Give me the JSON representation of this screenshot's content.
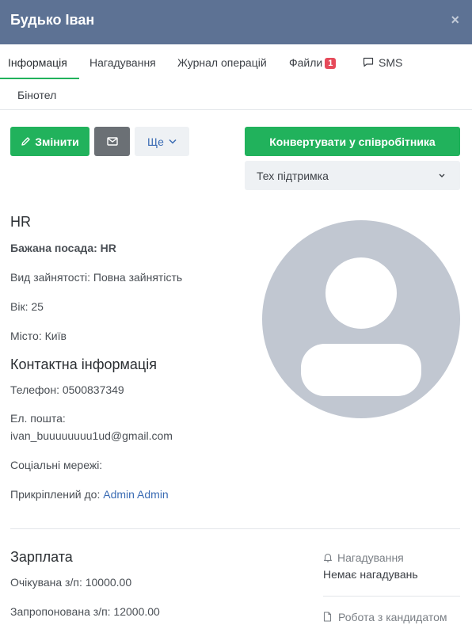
{
  "header": {
    "title": "Будько Іван",
    "close_glyph": "×"
  },
  "tabs": [
    {
      "label": "Інформація"
    },
    {
      "label": "Нагадування"
    },
    {
      "label": "Журнал операцій"
    },
    {
      "label": "Файли",
      "badge": "1"
    },
    {
      "label": "SMS",
      "icon": "chat-icon"
    },
    {
      "label": "Бінотел"
    }
  ],
  "toolbar": {
    "edit_label": "Змінити",
    "mail_icon": "envelope-icon",
    "more_label": "Ще",
    "convert_label": "Конвертувати у співробітника",
    "status_value": "Тех підтримка"
  },
  "info": {
    "title": "HR",
    "position_label": "Бажана посада: HR",
    "employment": "Вид зайнятості: Повна зайнятість",
    "age": "Вік: 25",
    "city": "Місто: Київ"
  },
  "contact": {
    "title": "Контактна інформація",
    "phone": "Телефон: 0500837349",
    "email_label": "Ел. пошта:",
    "email_value": "ivan_buuuuuuuu1ud@gmail.com",
    "social": "Соціальні мережі:",
    "attached_label": "Прикріплений до:",
    "attached_value": "Admin Admin"
  },
  "salary": {
    "title": "Зарплата",
    "expected": "Очікувана з/п: 10000.00",
    "offered": "Запропонована з/п: 12000.00"
  },
  "sidebar": {
    "reminders_label": "Нагадування",
    "reminders_empty": "Немає нагадувань",
    "work_label": "Робота з кандидатом"
  },
  "colors": {
    "header_bg": "#5d7294",
    "accent_green": "#21b25c",
    "link_blue": "#3b6cb4",
    "badge_red": "#e64a5a",
    "avatar_gray": "#c1c7d1"
  }
}
